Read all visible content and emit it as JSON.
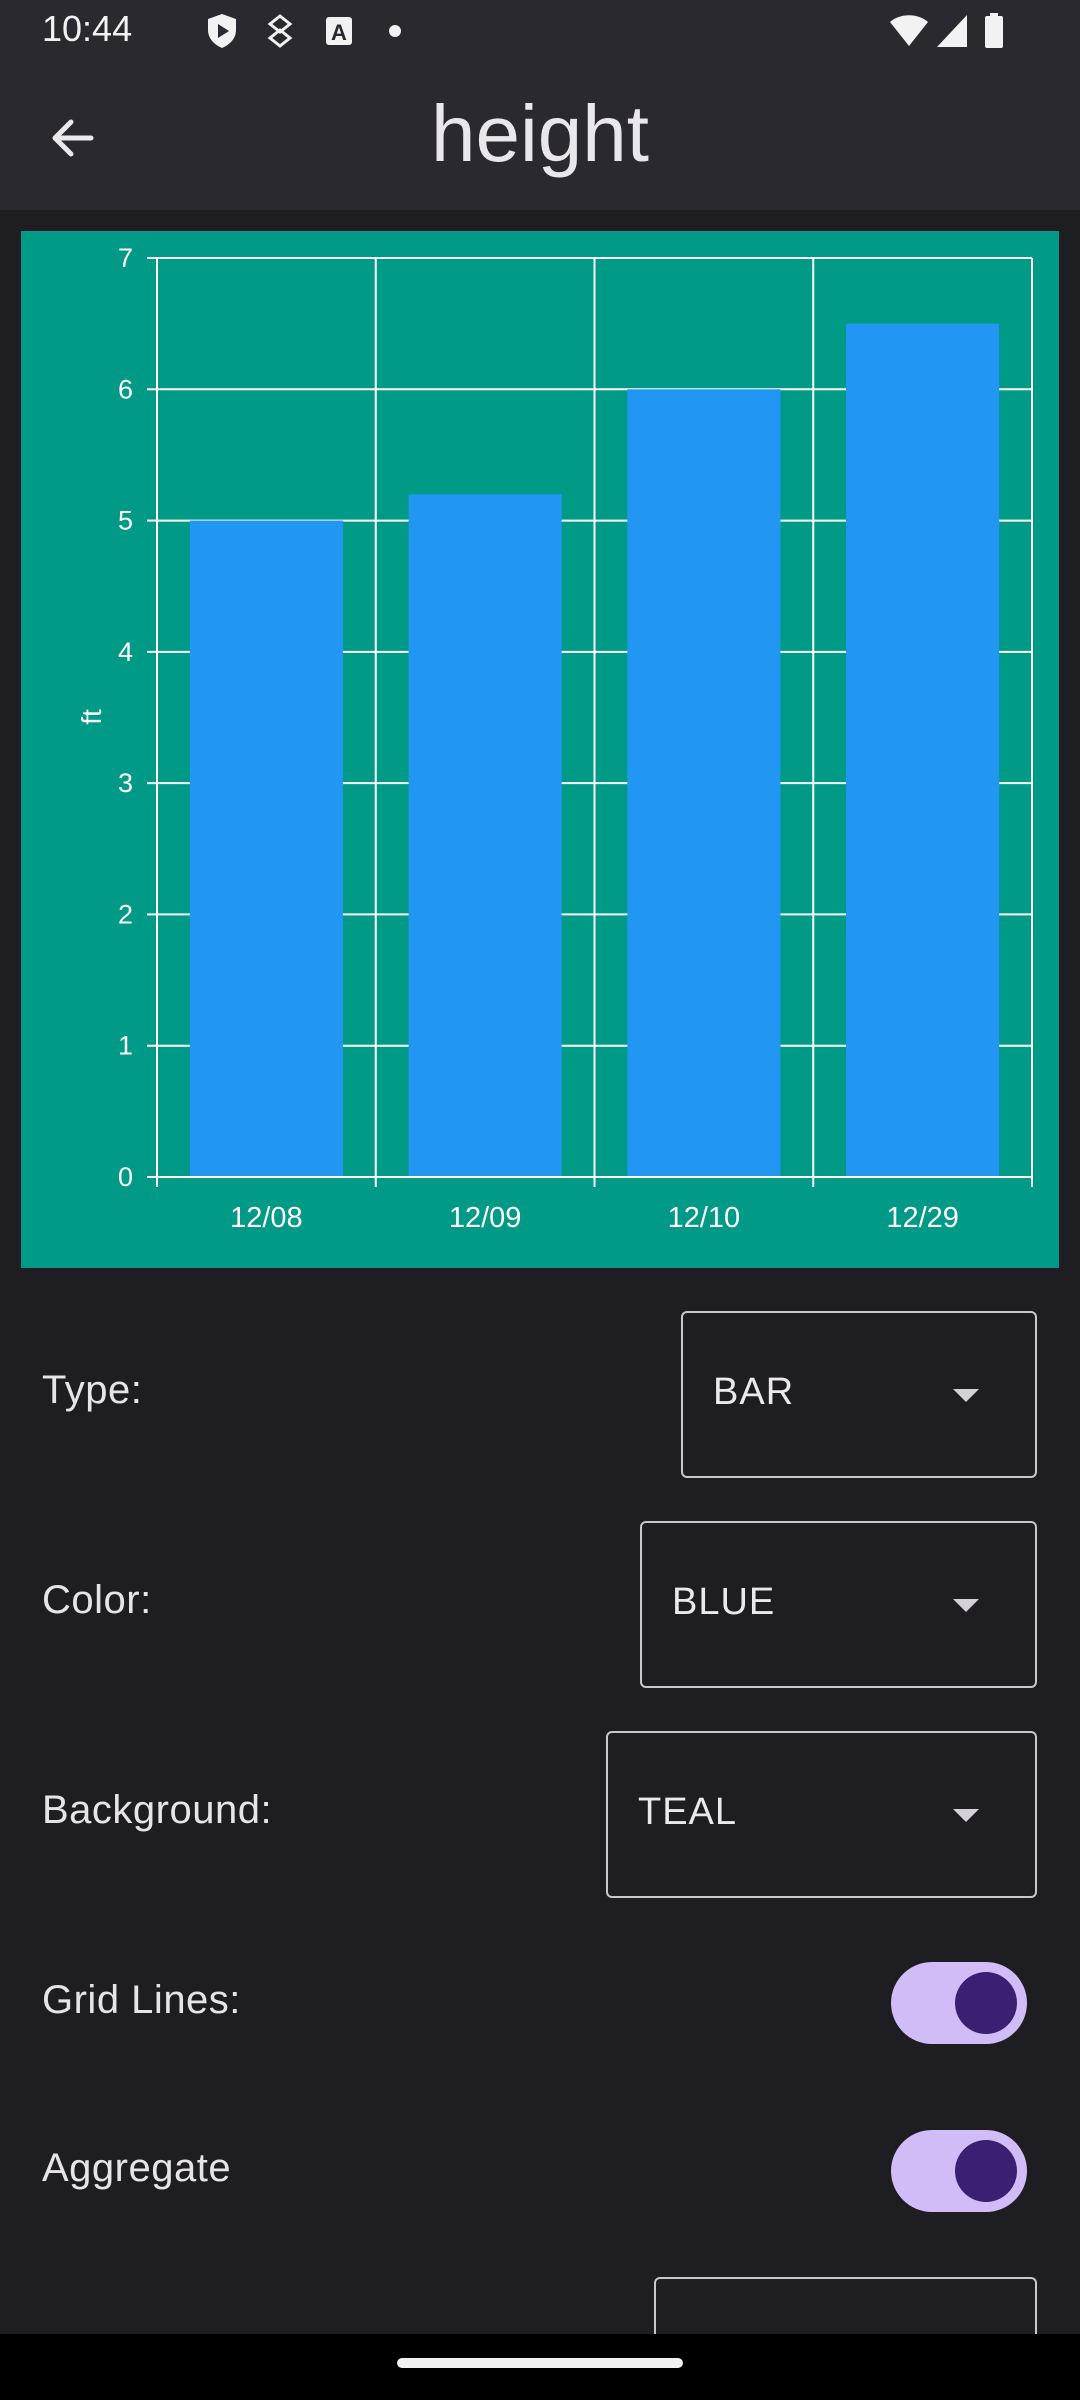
{
  "status_bar": {
    "time": "10:44",
    "icons": [
      "dot-icon",
      "shield-play-icon",
      "security-icon",
      "a-box-icon",
      "notification-dot-icon",
      "wifi-icon",
      "signal-icon",
      "battery-icon"
    ]
  },
  "app_bar": {
    "title": "height",
    "back_icon": "arrow-back-icon"
  },
  "chart_data": {
    "type": "bar",
    "categories": [
      "12/08",
      "12/09",
      "12/10",
      "12/29"
    ],
    "values": [
      5.0,
      5.2,
      6.0,
      6.5
    ],
    "ylabel": "ft",
    "ylim": [
      0,
      7
    ],
    "yticks": [
      0,
      1,
      2,
      3,
      4,
      5,
      6,
      7
    ],
    "grid": true,
    "bar_color": "#2196f3",
    "background_color": "#009a87"
  },
  "settings": {
    "type": {
      "label": "Type:",
      "value": "BAR"
    },
    "color": {
      "label": "Color:",
      "value": "BLUE"
    },
    "background": {
      "label": "Background:",
      "value": "TEAL"
    },
    "grid_lines": {
      "label": "Grid Lines:",
      "on": true
    },
    "aggregate": {
      "label": "Aggregate",
      "on": true
    }
  },
  "colors": {
    "surface": "#1e1d22",
    "app_bar": "#2a2930",
    "toggle_track": "#d0bcf7",
    "toggle_thumb": "#3a1f72"
  }
}
